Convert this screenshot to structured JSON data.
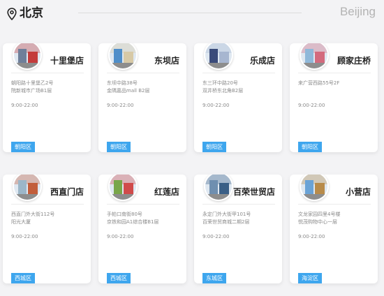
{
  "header": {
    "city": "北京",
    "city_en": "Beijing"
  },
  "stores": [
    {
      "name": "十里堡店",
      "addr1": "朝阳路十里堡乙2号",
      "addr2": "院新城市广场B1层",
      "hours": "9:00-22:00",
      "district": "朝阳区",
      "photo_colors": [
        "#6f7f9a",
        "#c43b3b"
      ]
    },
    {
      "name": "东坝店",
      "addr1": "东坝中路38号",
      "addr2": "金隅嘉品mall B2层",
      "hours": "9:00-22:00",
      "district": "朝阳区",
      "photo_colors": [
        "#4f8ec9",
        "#d7c9a6"
      ]
    },
    {
      "name": "乐成店",
      "addr1": "东三环中路20号",
      "addr2": "双井桥东北角B2层",
      "hours": "9:00-22:00",
      "district": "朝阳区",
      "photo_colors": [
        "#3a4b7a",
        "#a7b6d0"
      ]
    },
    {
      "name": "顾家庄桥",
      "addr1": "来广营西路55号2F",
      "addr2": "",
      "hours": "9:00-22:00",
      "district": "朝阳区",
      "photo_colors": [
        "#8fb8d9",
        "#d36a7d"
      ]
    },
    {
      "name": "西直门店",
      "addr1": "西直门外大街112号",
      "addr2": "阳光大厦",
      "hours": "9:00-22:00",
      "district": "西城区",
      "photo_colors": [
        "#9cb6c8",
        "#c25d3a"
      ]
    },
    {
      "name": "红莲店",
      "addr1": "手帕口南街80号",
      "addr2": "京铁和园A1综合楼B1层",
      "hours": "9:00-22:00",
      "district": "西城区",
      "photo_colors": [
        "#79a64a",
        "#d04b4b"
      ]
    },
    {
      "name": "百荣世贸店",
      "addr1": "永定门外大街甲101号",
      "addr2": "百荣世贸商城二期2层",
      "hours": "9:00-22:00",
      "district": "东城区",
      "photo_colors": [
        "#6f8fb0",
        "#3a5f86"
      ]
    },
    {
      "name": "小营店",
      "addr1": "文龙家园四里4号楼",
      "addr2": "悦茂购物中心一层",
      "hours": "9:00-22:00",
      "district": "海淀区",
      "photo_colors": [
        "#6aa3d6",
        "#b88b4a"
      ]
    }
  ]
}
